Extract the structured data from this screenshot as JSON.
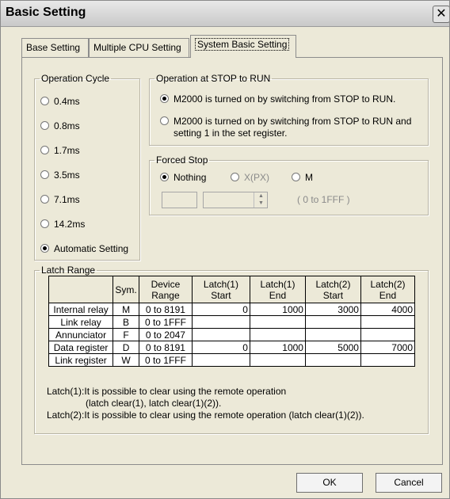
{
  "window": {
    "title": "Basic Setting",
    "close_glyph": "✕"
  },
  "tabs": [
    {
      "label": "Base Setting",
      "active": false
    },
    {
      "label": "Multiple CPU Setting",
      "active": false
    },
    {
      "label": "System Basic Setting",
      "active": true
    }
  ],
  "operation_cycle": {
    "legend": "Operation Cycle",
    "options": [
      {
        "label": "0.4ms",
        "selected": false
      },
      {
        "label": "0.8ms",
        "selected": false
      },
      {
        "label": "1.7ms",
        "selected": false
      },
      {
        "label": "3.5ms",
        "selected": false
      },
      {
        "label": "7.1ms",
        "selected": false
      },
      {
        "label": "14.2ms",
        "selected": false
      },
      {
        "label": "Automatic Setting",
        "selected": true
      }
    ]
  },
  "stop_to_run": {
    "legend": "Operation at STOP to RUN",
    "options": [
      {
        "label": "M2000 is turned on by switching from STOP to RUN.",
        "selected": true
      },
      {
        "label": "M2000 is turned on by switching from STOP to RUN and setting 1 in the set register.",
        "selected": false
      }
    ]
  },
  "forced_stop": {
    "legend": "Forced Stop",
    "options": [
      {
        "label": "Nothing",
        "selected": true
      },
      {
        "label": "X(PX)",
        "selected": false
      },
      {
        "label": "M",
        "selected": false
      }
    ],
    "range_hint": "(    0 to 1FFF    )"
  },
  "latch_range": {
    "legend": "Latch Range",
    "headers": {
      "sym": "Sym.",
      "device_1": "Device",
      "device_2": "Range",
      "l1s_1": "Latch(1)",
      "l1s_2": "Start",
      "l1e_1": "Latch(1)",
      "l1e_2": "End",
      "l2s_1": "Latch(2)",
      "l2s_2": "Start",
      "l2e_1": "Latch(2)",
      "l2e_2": "End"
    },
    "rows": [
      {
        "name": "Internal relay",
        "sym": "M",
        "range": "0 to 8191",
        "l1_start": "0",
        "l1_end": "1000",
        "l2_start": "3000",
        "l2_end": "4000"
      },
      {
        "name": "Link relay",
        "sym": "B",
        "range": "0 to 1FFF",
        "l1_start": "",
        "l1_end": "",
        "l2_start": "",
        "l2_end": ""
      },
      {
        "name": "Annunciator",
        "sym": "F",
        "range": "0 to 2047",
        "l1_start": "",
        "l1_end": "",
        "l2_start": "",
        "l2_end": ""
      },
      {
        "name": "Data register",
        "sym": "D",
        "range": "0 to 8191",
        "l1_start": "0",
        "l1_end": "1000",
        "l2_start": "5000",
        "l2_end": "7000"
      },
      {
        "name": "Link register",
        "sym": "W",
        "range": "0 to 1FFF",
        "l1_start": "",
        "l1_end": "",
        "l2_start": "",
        "l2_end": ""
      }
    ],
    "notes": [
      "Latch(1):It is possible to clear using the remote operation",
      "(latch clear(1), latch clear(1)(2)).",
      "Latch(2):It is possible to clear using the remote operation (latch clear(1)(2))."
    ]
  },
  "buttons": {
    "ok": "OK",
    "cancel": "Cancel"
  }
}
